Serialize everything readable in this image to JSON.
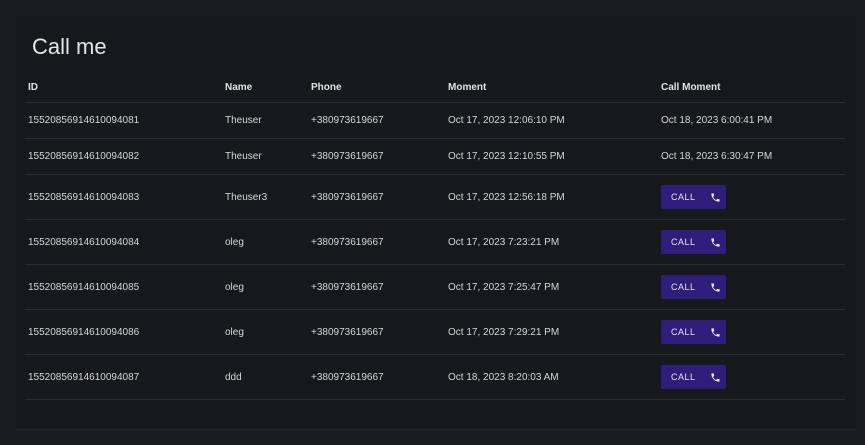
{
  "page": {
    "title": "Call me"
  },
  "table": {
    "headers": {
      "id": "ID",
      "name": "Name",
      "phone": "Phone",
      "moment": "Moment",
      "call_moment": "Call Moment"
    },
    "call_button_label": "CALL",
    "call_icon": "phone-icon",
    "rows": [
      {
        "id": "15520856914610094081",
        "name": "Theuser",
        "phone": "+380973619667",
        "moment": "Oct 17, 2023 12:06:10 PM",
        "call_moment": "Oct 18, 2023 6:00:41 PM"
      },
      {
        "id": "15520856914610094082",
        "name": "Theuser",
        "phone": "+380973619667",
        "moment": "Oct 17, 2023 12:10:55 PM",
        "call_moment": "Oct 18, 2023 6:30:47 PM"
      },
      {
        "id": "15520856914610094083",
        "name": "Theuser3",
        "phone": "+380973619667",
        "moment": "Oct 17, 2023 12:56:18 PM",
        "call_moment": null
      },
      {
        "id": "15520856914610094084",
        "name": "oleg",
        "phone": "+380973619667",
        "moment": "Oct 17, 2023 7:23:21 PM",
        "call_moment": null
      },
      {
        "id": "15520856914610094085",
        "name": "oleg",
        "phone": "+380973619667",
        "moment": "Oct 17, 2023 7:25:47 PM",
        "call_moment": null
      },
      {
        "id": "15520856914610094086",
        "name": "oleg",
        "phone": "+380973619667",
        "moment": "Oct 17, 2023 7:29:21 PM",
        "call_moment": null
      },
      {
        "id": "15520856914610094087",
        "name": "ddd",
        "phone": "+380973619667",
        "moment": "Oct 18, 2023 8:20:03 AM",
        "call_moment": null
      }
    ]
  },
  "colors": {
    "background": "#1b1c1f",
    "panel": "#17181b",
    "call_button": "#2e1d7a"
  }
}
